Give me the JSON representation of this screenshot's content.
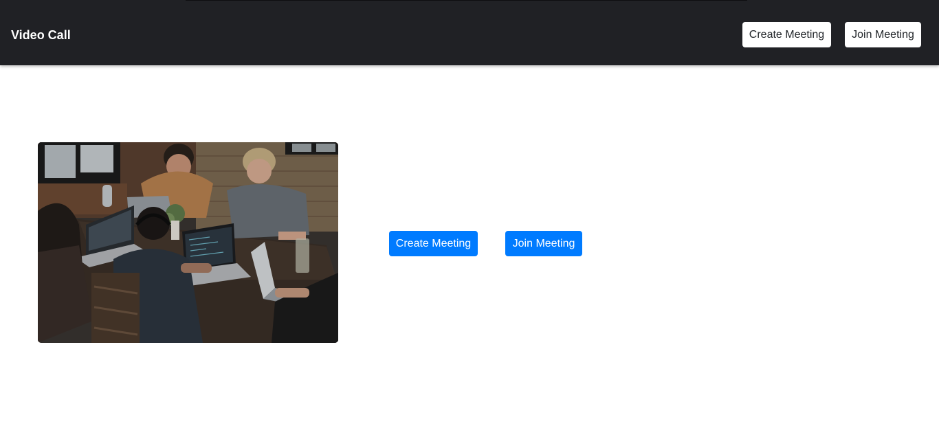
{
  "navbar": {
    "brand": "Video Call",
    "create_label": "Create Meeting",
    "join_label": "Join Meeting"
  },
  "main": {
    "image_alt": "people working on laptops around a table",
    "create_label": "Create Meeting",
    "join_label": "Join Meeting"
  },
  "colors": {
    "navbar_bg": "#202125",
    "primary": "#007bff",
    "page_bg": "#ffffff"
  }
}
